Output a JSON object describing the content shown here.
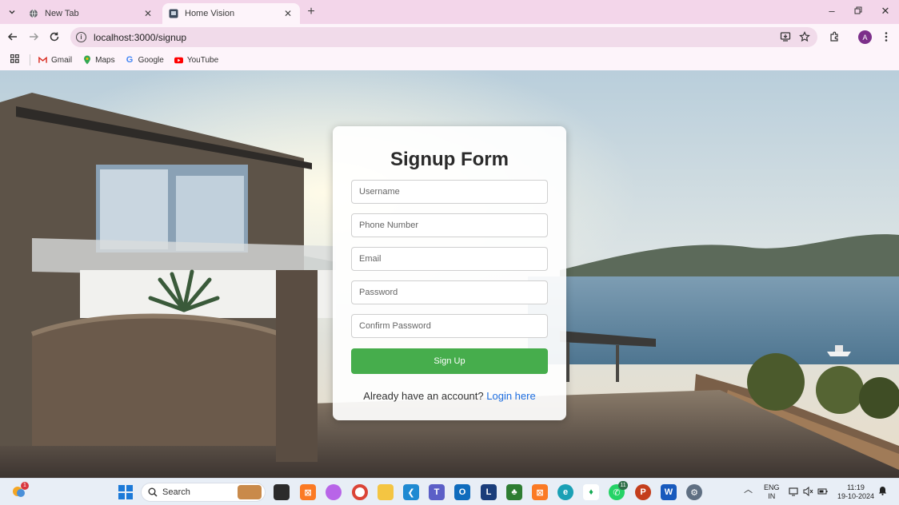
{
  "browser": {
    "tabs": [
      {
        "title": "New Tab",
        "active": false
      },
      {
        "title": "Home Vision",
        "active": true
      }
    ],
    "address": "localhost:3000/signup",
    "profile_initial": "A",
    "bookmarks": [
      "Gmail",
      "Maps",
      "Google",
      "YouTube"
    ]
  },
  "signup": {
    "title": "Signup Form",
    "fields": {
      "username": {
        "placeholder": "Username",
        "value": ""
      },
      "phone": {
        "placeholder": "Phone Number",
        "value": ""
      },
      "email": {
        "placeholder": "Email",
        "value": ""
      },
      "password": {
        "placeholder": "Password",
        "value": ""
      },
      "confirm_password": {
        "placeholder": "Confirm Password",
        "value": ""
      }
    },
    "submit_label": "Sign Up",
    "login_prompt": "Already have an account?",
    "login_link": "Login here",
    "colors": {
      "button": "#46ad4c",
      "link": "#1f6fe0"
    }
  },
  "taskbar": {
    "search_label": "Search",
    "widget_badge": "1",
    "whatsapp_badge": "11",
    "language": [
      "ENG",
      "IN"
    ],
    "time": "11:19",
    "date": "19-10-2024",
    "icons": [
      "weather-icon",
      "start-icon",
      "search-icon",
      "file-explorer-icon",
      "xampp-icon",
      "copilot-icon",
      "chrome-icon",
      "folder-icon",
      "vscode-icon",
      "teams-icon",
      "outlook-icon",
      "l-app-icon",
      "app-icon",
      "xampp-icon",
      "edge-icon",
      "mongodb-icon",
      "whatsapp-icon",
      "powerpoint-icon",
      "word-icon",
      "settings-icon"
    ]
  }
}
